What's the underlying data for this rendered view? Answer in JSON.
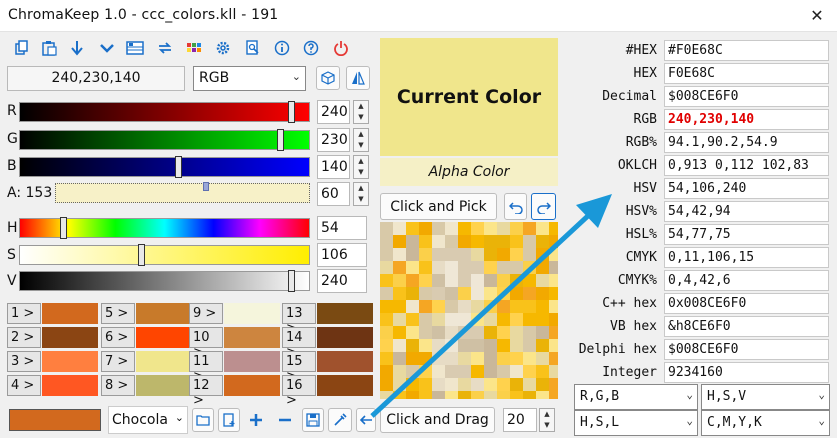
{
  "window": {
    "title": "ChromaKeep 1.0 - ccc_colors.kll - 191",
    "close_glyph": "✕"
  },
  "toolbar": {
    "icons": [
      "copy-icon",
      "paste-icon",
      "arrow-down-icon",
      "chevron-down-icon",
      "picture-icon",
      "swap-icon",
      "palette-grid-icon",
      "gear-icon",
      "search-doc-icon",
      "info-icon",
      "help-icon",
      "power-icon"
    ]
  },
  "color_value": "240,230,140",
  "model_select": "RGB",
  "sliders": {
    "r": {
      "label": "R",
      "value": "240"
    },
    "g": {
      "label": "G",
      "value": "230"
    },
    "b": {
      "label": "B",
      "value": "140"
    },
    "a": {
      "label": "A: 153",
      "value": "60"
    },
    "h": {
      "label": "H",
      "value": "54"
    },
    "s": {
      "label": "S",
      "value": "106"
    },
    "v": {
      "label": "V",
      "value": "240"
    }
  },
  "swatches": [
    {
      "label": "1 >",
      "color": "#D2691E"
    },
    {
      "label": "5 >",
      "color": "#C87A2A"
    },
    {
      "label": "9 >",
      "color": "#F5F5DC"
    },
    {
      "label": "13 >",
      "color": "#7A4A12"
    },
    {
      "label": "2 >",
      "color": "#8B4513"
    },
    {
      "label": "6 >",
      "color": "#FF4500"
    },
    {
      "label": "10 >",
      "color": "#CD853F"
    },
    {
      "label": "14 >",
      "color": "#6E3413"
    },
    {
      "label": "3 >",
      "color": "#FF7F3F"
    },
    {
      "label": "7 >",
      "color": "#F0E68C"
    },
    {
      "label": "11 >",
      "color": "#BC8F8F"
    },
    {
      "label": "15 >",
      "color": "#A0522D"
    },
    {
      "label": "4 >",
      "color": "#FF5722"
    },
    {
      "label": "8 >",
      "color": "#BDB76B"
    },
    {
      "label": "12 >",
      "color": "#D2691E"
    },
    {
      "label": "16 >",
      "color": "#8B4513"
    }
  ],
  "bottom": {
    "color_name": "Chocola",
    "swatch_color": "#D2691E",
    "drag_label": "Click and Drag",
    "drag_value": "20"
  },
  "preview": {
    "current_label": "Current Color",
    "alpha_label": "Alpha Color",
    "pick_label": "Click and Pick",
    "color": "#F0E68C"
  },
  "readouts": [
    {
      "label": "#HEX",
      "value": "#F0E68C"
    },
    {
      "label": "HEX",
      "value": "F0E68C"
    },
    {
      "label": "Decimal",
      "value": "$008CE6F0"
    },
    {
      "label": "RGB",
      "value": "240,230,140"
    },
    {
      "label": "RGB%",
      "value": "94.1,90.2,54.9"
    },
    {
      "label": "OKLCH",
      "value": "0,913 0,112 102,83"
    },
    {
      "label": "HSV",
      "value": "54,106,240"
    },
    {
      "label": "HSV%",
      "value": "54,42,94"
    },
    {
      "label": "HSL%",
      "value": "54,77,75"
    },
    {
      "label": "CMYK",
      "value": "0,11,106,15"
    },
    {
      "label": "CMYK%",
      "value": "0,4,42,6"
    },
    {
      "label": "C++ hex",
      "value": "0x008CE6F0"
    },
    {
      "label": "VB hex",
      "value": "&h8CE6F0"
    },
    {
      "label": "Delphi hex",
      "value": "$008CE6F0"
    },
    {
      "label": "Integer",
      "value": "9234160"
    }
  ],
  "format_selects": [
    "R,G,B",
    "H,S,V",
    "H,S,L",
    "C,M,Y,K"
  ]
}
